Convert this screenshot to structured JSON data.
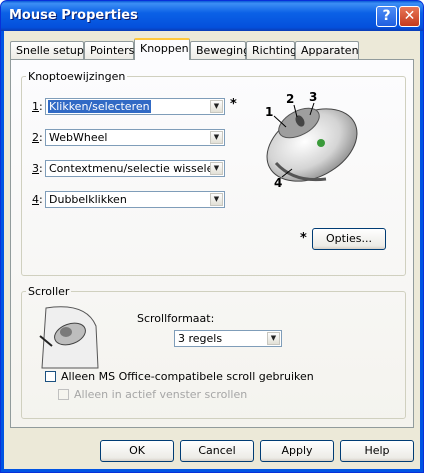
{
  "window": {
    "title": "Mouse Properties",
    "help_glyph": "?",
    "close_glyph": "✕"
  },
  "tabs": [
    "Snelle setup",
    "Pointers",
    "Knoppen",
    "Beweging",
    "Richting",
    "Apparaten"
  ],
  "active_tab": "Knoppen",
  "buttons_group": {
    "legend": "Knoptoewijzingen",
    "rows": [
      {
        "num": "1",
        "value": "Klikken/selecteren"
      },
      {
        "num": "2",
        "value": "WebWheel"
      },
      {
        "num": "3",
        "value": "Contextmenu/selectie wisselen"
      },
      {
        "num": "4",
        "value": "Dubbelklikken"
      }
    ],
    "star": "*",
    "callouts": [
      "1",
      "2",
      "3",
      "4"
    ],
    "options_star": "*",
    "options_button": "Opties..."
  },
  "scroller_group": {
    "legend": "Scroller",
    "format_label": "Scrollformaat:",
    "format_value": "3 regels",
    "office_only": {
      "label": "Alleen MS Office-compatibele scroll gebruiken",
      "checked": false
    },
    "active_window_only": {
      "label": "Alleen in actief venster scrollen",
      "checked": false,
      "disabled": true
    }
  },
  "dialog_buttons": {
    "ok": "OK",
    "cancel": "Cancel",
    "apply": "Apply",
    "help": "Help"
  },
  "colors": {
    "titlebar": "#0054e3",
    "selection": "#316ac5",
    "close": "#c4391c"
  }
}
